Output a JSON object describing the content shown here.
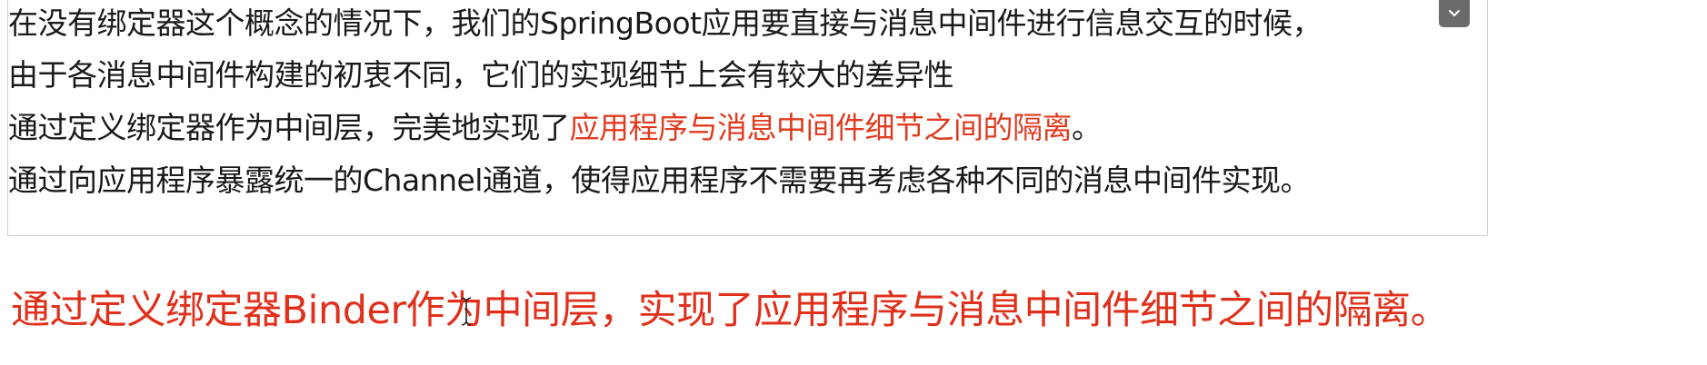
{
  "note": {
    "line1": "在没有绑定器这个概念的情况下，我们的SpringBoot应用要直接与消息中间件进行信息交互的时候，",
    "line2": "由于各消息中间件构建的初衷不同，它们的实现细节上会有较大的差异性",
    "line3_prefix": "通过定义绑定器作为中间层，完美地实现了",
    "line3_highlight": "应用程序与消息中间件细节之间的隔离",
    "line3_suffix": "。",
    "line4": "通过向应用程序暴露统一的Channel通道，使得应用程序不需要再考虑各种不同的消息中间件实现。"
  },
  "collapse_button": {
    "icon": "chevron-down-icon"
  },
  "annotation": {
    "text": "通过定义绑定器Binder作为中间层，实现了应用程序与消息中间件细节之间的隔离。"
  },
  "colors": {
    "highlight": "#e03b1f",
    "annotation": "#e0301b",
    "button": "#6b6b6b"
  }
}
